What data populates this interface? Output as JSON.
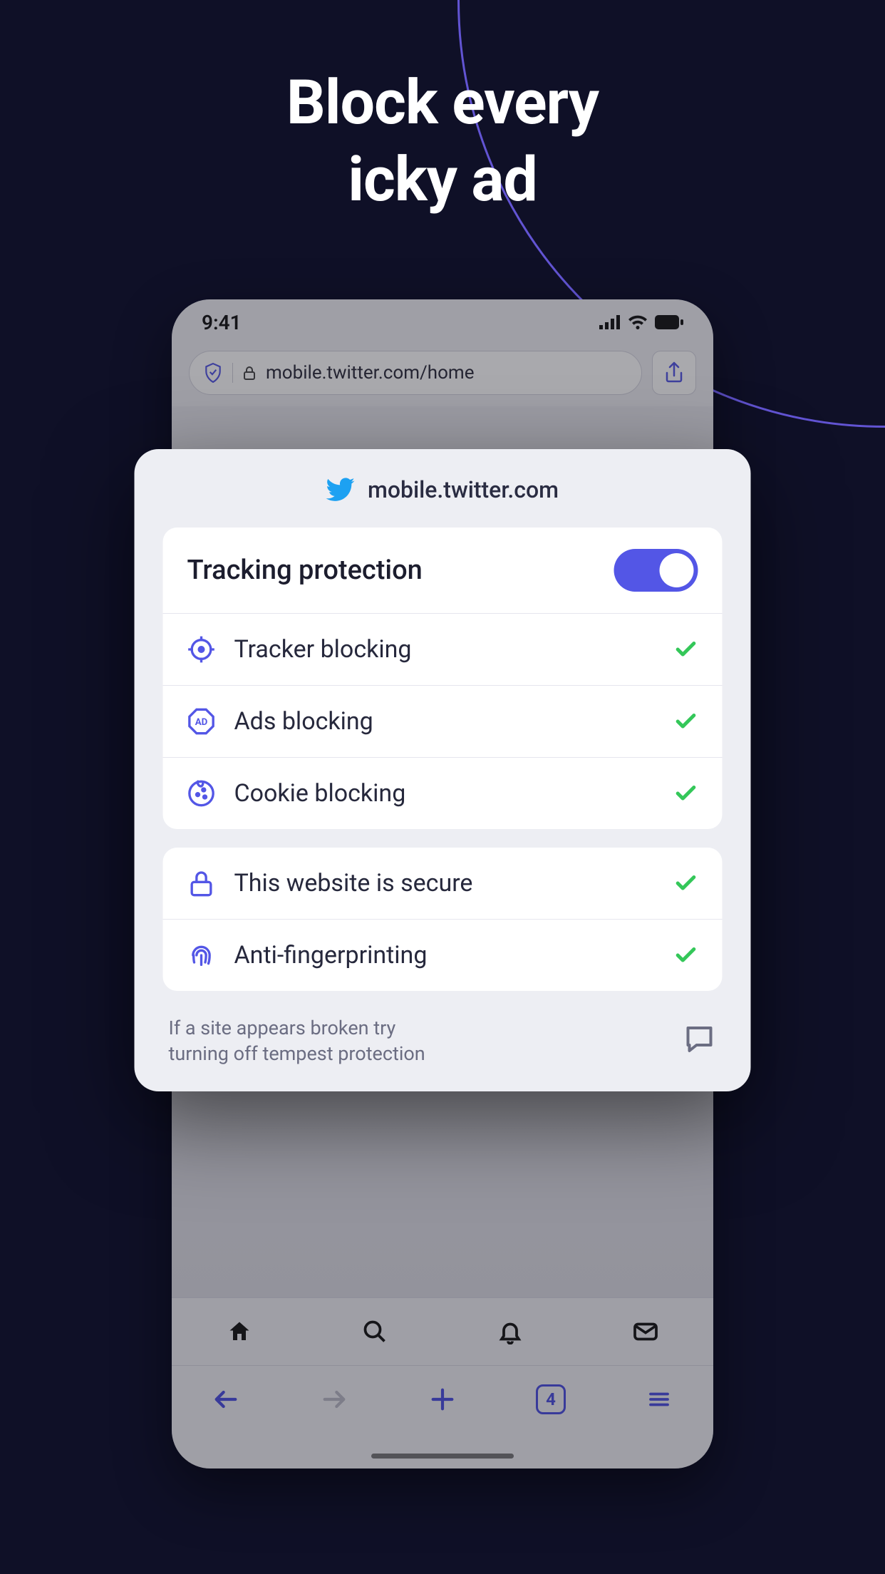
{
  "headline_line1": "Block every",
  "headline_line2": "icky ad",
  "phone": {
    "status": {
      "time": "9:41"
    },
    "url_bar": {
      "url": "mobile.twitter.com/home"
    },
    "toolbar": {
      "tab_count": "4"
    }
  },
  "panel": {
    "site": "mobile.twitter.com",
    "tracking_protection_label": "Tracking protection",
    "tracking_protection_on": true,
    "items_group1": [
      {
        "icon": "target-icon",
        "label": "Tracker blocking"
      },
      {
        "icon": "ad-icon",
        "label": "Ads blocking"
      },
      {
        "icon": "cookie-icon",
        "label": "Cookie blocking"
      }
    ],
    "items_group2": [
      {
        "icon": "lock-icon",
        "label": "This website is secure"
      },
      {
        "icon": "fingerprint-icon",
        "label": "Anti-fingerprinting"
      }
    ],
    "footer_note_line1": "If a site appears broken try",
    "footer_note_line2": "turning off tempest protection"
  }
}
